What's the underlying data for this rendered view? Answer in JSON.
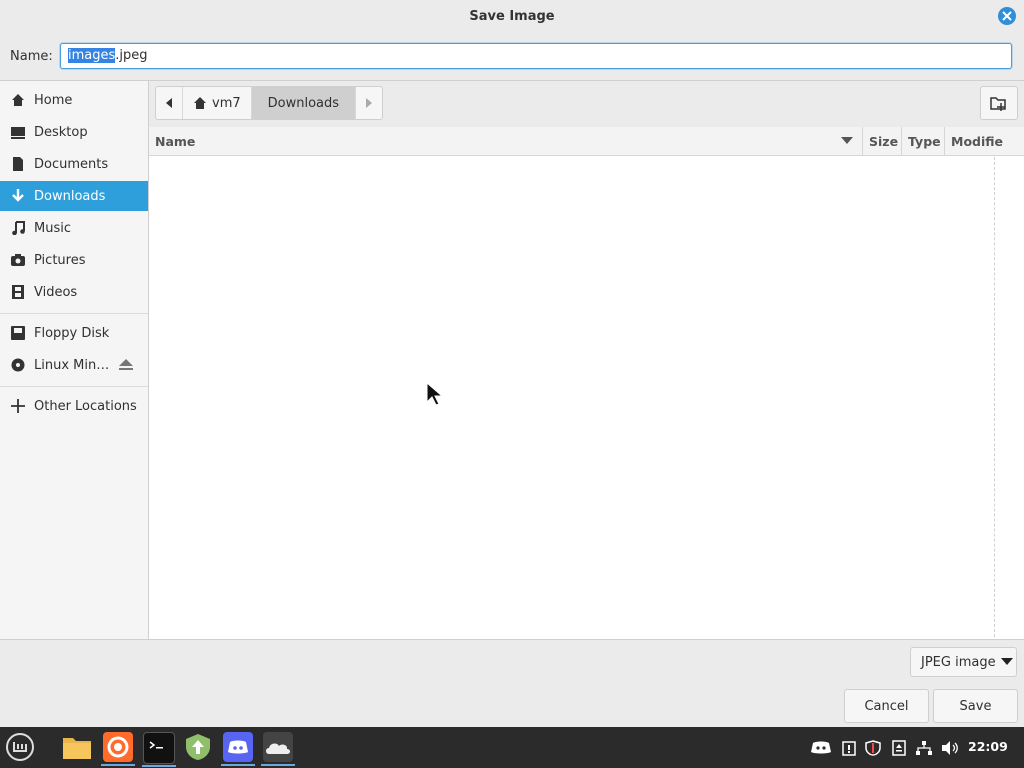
{
  "window": {
    "title": "Save Image"
  },
  "name_row": {
    "label": "Name:",
    "value_selected": "images",
    "value_rest": ".jpeg"
  },
  "sidebar": {
    "items": [
      {
        "label": "Home",
        "icon": "home-icon"
      },
      {
        "label": "Desktop",
        "icon": "desktop-icon"
      },
      {
        "label": "Documents",
        "icon": "documents-icon"
      },
      {
        "label": "Downloads",
        "icon": "downloads-icon",
        "active": true
      },
      {
        "label": "Music",
        "icon": "music-icon"
      },
      {
        "label": "Pictures",
        "icon": "camera-icon"
      },
      {
        "label": "Videos",
        "icon": "film-icon"
      }
    ],
    "devices": [
      {
        "label": "Floppy Disk",
        "icon": "floppy-icon"
      },
      {
        "label": "Linux Min…",
        "icon": "disc-icon",
        "eject": true
      }
    ],
    "other": {
      "label": "Other Locations",
      "icon": "plus-icon"
    }
  },
  "pathbar": {
    "crumbs": [
      "vm7",
      "Downloads"
    ]
  },
  "columns": {
    "name": "Name",
    "size": "Size",
    "type": "Type",
    "modified": "Modifie"
  },
  "filetype": {
    "selected": "JPEG image"
  },
  "buttons": {
    "cancel": "Cancel",
    "save": "Save"
  },
  "taskbar": {
    "apps": [
      "menu-icon",
      "files-icon",
      "firefox-icon",
      "terminal-icon",
      "update-manager-icon",
      "discord-icon",
      "onedrive-icon"
    ],
    "clock": "22:09"
  },
  "colors": {
    "accent": "#2f9fdb",
    "selection": "#3584e4",
    "taskbar": "#2b2b2b"
  }
}
